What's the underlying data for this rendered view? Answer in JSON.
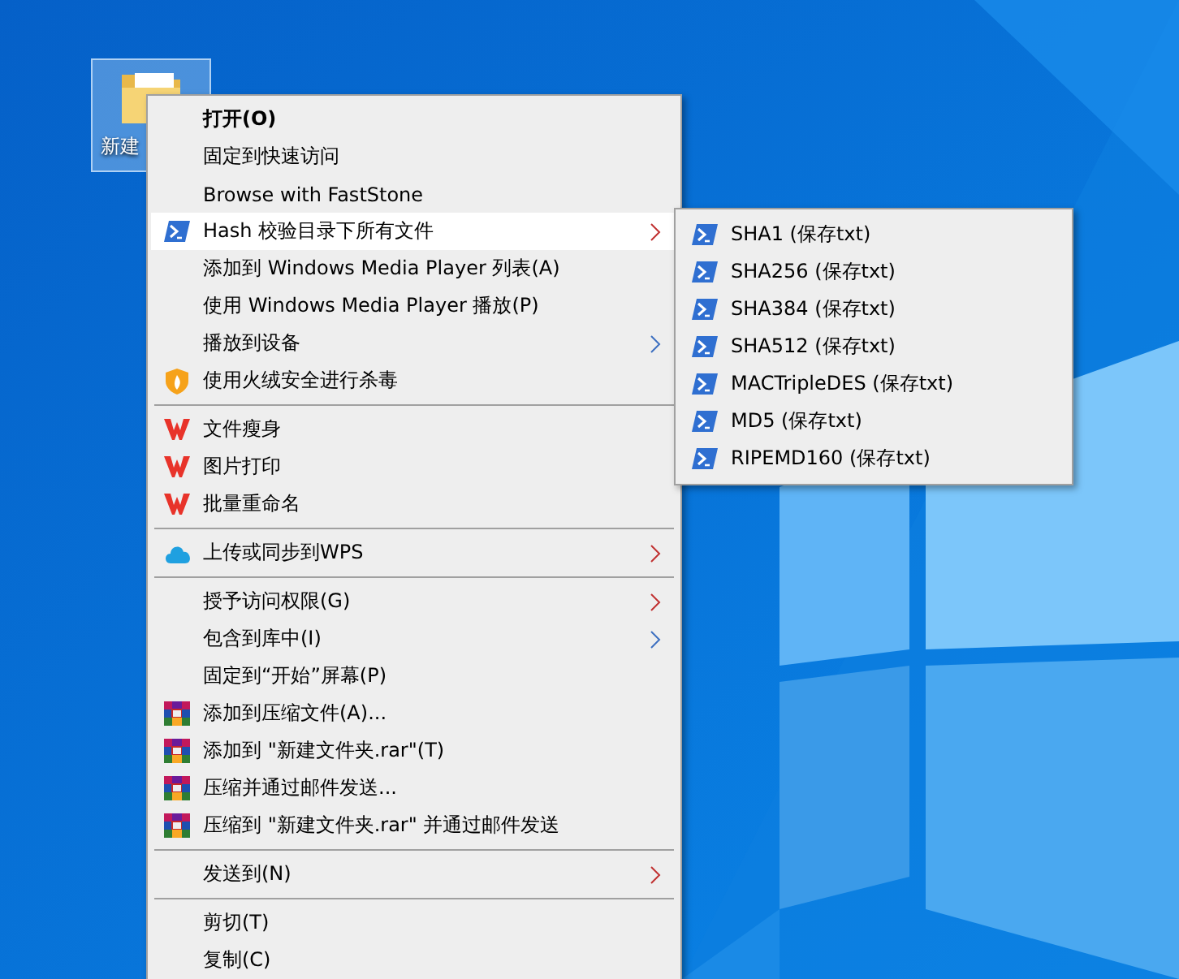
{
  "desktop_icon": {
    "label": "新建",
    "selected": true
  },
  "menu": {
    "groups": [
      [
        {
          "label": "打开(O)",
          "kind": "plain",
          "default": true,
          "selected": false,
          "submenu": false
        },
        {
          "label": "固定到快速访问",
          "kind": "plain",
          "default": false,
          "selected": false,
          "submenu": false
        },
        {
          "label": "Browse with FastStone",
          "kind": "plain",
          "default": false,
          "selected": false,
          "submenu": false
        },
        {
          "label": "Hash 校验目录下所有文件",
          "kind": "script",
          "default": false,
          "selected": true,
          "submenu": true
        },
        {
          "label": "添加到 Windows Media Player 列表(A)",
          "kind": "plain",
          "default": false,
          "selected": false,
          "submenu": false
        },
        {
          "label": "使用 Windows Media Player 播放(P)",
          "kind": "plain",
          "default": false,
          "selected": false,
          "submenu": false
        },
        {
          "label": "播放到设备",
          "kind": "plain",
          "default": false,
          "selected": false,
          "submenu": true
        },
        {
          "label": "使用火绒安全进行杀毒",
          "kind": "shield",
          "default": false,
          "selected": false,
          "submenu": false
        }
      ],
      [
        {
          "label": "文件瘦身",
          "kind": "wps",
          "default": false,
          "selected": false,
          "submenu": false
        },
        {
          "label": "图片打印",
          "kind": "wps",
          "default": false,
          "selected": false,
          "submenu": false
        },
        {
          "label": "批量重命名",
          "kind": "wps",
          "default": false,
          "selected": false,
          "submenu": false
        }
      ],
      [
        {
          "label": "上传或同步到WPS",
          "kind": "cloud",
          "default": false,
          "selected": false,
          "submenu": true
        }
      ],
      [
        {
          "label": "授予访问权限(G)",
          "kind": "plain",
          "default": false,
          "selected": false,
          "submenu": true
        },
        {
          "label": "包含到库中(I)",
          "kind": "plain",
          "default": false,
          "selected": false,
          "submenu": true
        },
        {
          "label": "固定到“开始”屏幕(P)",
          "kind": "plain",
          "default": false,
          "selected": false,
          "submenu": false
        },
        {
          "label": "添加到压缩文件(A)...",
          "kind": "archive",
          "default": false,
          "selected": false,
          "submenu": false
        },
        {
          "label": "添加到 \"新建文件夹.rar\"(T)",
          "kind": "archive",
          "default": false,
          "selected": false,
          "submenu": false
        },
        {
          "label": "压缩并通过邮件发送...",
          "kind": "archive",
          "default": false,
          "selected": false,
          "submenu": false
        },
        {
          "label": "压缩到 \"新建文件夹.rar\" 并通过邮件发送",
          "kind": "archive",
          "default": false,
          "selected": false,
          "submenu": false
        }
      ],
      [
        {
          "label": "发送到(N)",
          "kind": "plain",
          "default": false,
          "selected": false,
          "submenu": true
        }
      ],
      [
        {
          "label": "剪切(T)",
          "kind": "plain",
          "default": false,
          "selected": false,
          "submenu": false
        },
        {
          "label": "复制(C)",
          "kind": "plain",
          "default": false,
          "selected": false,
          "submenu": false
        }
      ]
    ]
  },
  "submenu": {
    "items": [
      {
        "label": "SHA1 (保存txt)",
        "kind": "script",
        "selected": false
      },
      {
        "label": "SHA256 (保存txt)",
        "kind": "script",
        "selected": false
      },
      {
        "label": "SHA384 (保存txt)",
        "kind": "script",
        "selected": false
      },
      {
        "label": "SHA512 (保存txt)",
        "kind": "script",
        "selected": false
      },
      {
        "label": "MACTripleDES (保存txt)",
        "kind": "script",
        "selected": false
      },
      {
        "label": "MD5 (保存txt)",
        "kind": "script",
        "selected": false
      },
      {
        "label": "RIPEMD160 (保存txt)",
        "kind": "script",
        "selected": false
      }
    ]
  }
}
